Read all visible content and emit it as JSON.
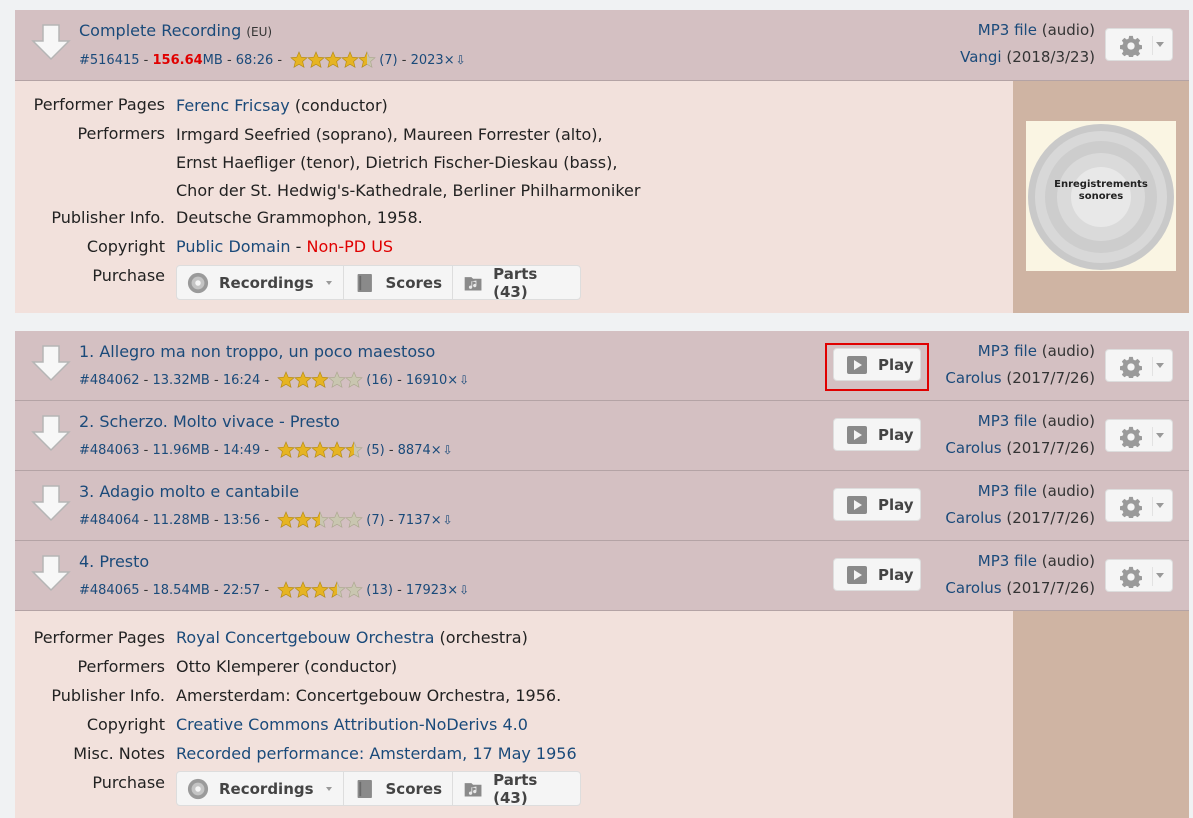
{
  "complete": {
    "title": "Complete Recording",
    "region": "(EU)",
    "id": "#516415",
    "size_num": "156.64",
    "size_unit": "MB",
    "duration": "68:26",
    "rating": 4.5,
    "rating_count": "(7)",
    "downloads": "2023×",
    "file_type_link": "MP3 file",
    "file_type_note": "(audio)",
    "uploader": "Vangi",
    "date": "(2018/3/23)"
  },
  "info1": {
    "performer_pages_label": "Performer Pages",
    "performer_pages_link": "Ferenc Fricsay",
    "performer_pages_note": "(conductor)",
    "performers_label": "Performers",
    "performers_lines": [
      "Irmgard Seefried (soprano), Maureen Forrester (alto),",
      "Ernst Haefliger (tenor), Dietrich Fischer-Dieskau (bass),",
      "Chor der St. Hedwig's-Kathedrale, Berliner Philharmoniker"
    ],
    "publisher_label": "Publisher Info.",
    "publisher": "Deutsche Grammophon, 1958.",
    "copyright_label": "Copyright",
    "copyright_link": "Public Domain",
    "copyright_sep": " - ",
    "copyright_nonpd": "Non-PD US",
    "purchase_label": "Purchase",
    "cover_text_1": "Enregistrements",
    "cover_text_2": "sonores"
  },
  "purchase": {
    "recordings": "Recordings",
    "scores": "Scores",
    "parts": "Parts (43)"
  },
  "tracks": [
    {
      "title": "1. Allegro ma non troppo, un poco maestoso",
      "id": "#484062",
      "size": "13.32MB",
      "duration": "16:24",
      "rating": 3,
      "rating_count": "(16)",
      "downloads": "16910×",
      "play": "Play",
      "file_type_link": "MP3 file",
      "file_type_note": "(audio)",
      "uploader": "Carolus",
      "date": "(2017/7/26)"
    },
    {
      "title": "2. Scherzo. Molto vivace - Presto",
      "id": "#484063",
      "size": "11.96MB",
      "duration": "14:49",
      "rating": 4.5,
      "rating_count": "(5)",
      "downloads": "8874×",
      "play": "Play",
      "file_type_link": "MP3 file",
      "file_type_note": "(audio)",
      "uploader": "Carolus",
      "date": "(2017/7/26)"
    },
    {
      "title": "3. Adagio molto e cantabile",
      "id": "#484064",
      "size": "11.28MB",
      "duration": "13:56",
      "rating": 2.5,
      "rating_count": "(7)",
      "downloads": "7137×",
      "play": "Play",
      "file_type_link": "MP3 file",
      "file_type_note": "(audio)",
      "uploader": "Carolus",
      "date": "(2017/7/26)"
    },
    {
      "title": "4. Presto",
      "id": "#484065",
      "size": "18.54MB",
      "duration": "22:57",
      "rating": 3.5,
      "rating_count": "(13)",
      "downloads": "17923×",
      "play": "Play",
      "file_type_link": "MP3 file",
      "file_type_note": "(audio)",
      "uploader": "Carolus",
      "date": "(2017/7/26)"
    }
  ],
  "info2": {
    "performer_pages_label": "Performer Pages",
    "performer_pages_link": "Royal Concertgebouw Orchestra",
    "performer_pages_note": "(orchestra)",
    "performers_label": "Performers",
    "performers": "Otto Klemperer (conductor)",
    "publisher_label": "Publisher Info.",
    "publisher": "Amersterdam: Concertgebouw Orchestra, 1956.",
    "copyright_label": "Copyright",
    "copyright_link": "Creative Commons Attribution-NoDerivs 4.0",
    "misc_label": "Misc. Notes",
    "misc_link": "Recorded performance: Amsterdam, 17 May 1956",
    "purchase_label": "Purchase"
  },
  "colors": {
    "row_bg": "#d4c0c2",
    "info_bg": "#f2e1dc",
    "side_bg": "#cfb4a3",
    "link": "#1a4a7a",
    "red": "#e00000"
  }
}
